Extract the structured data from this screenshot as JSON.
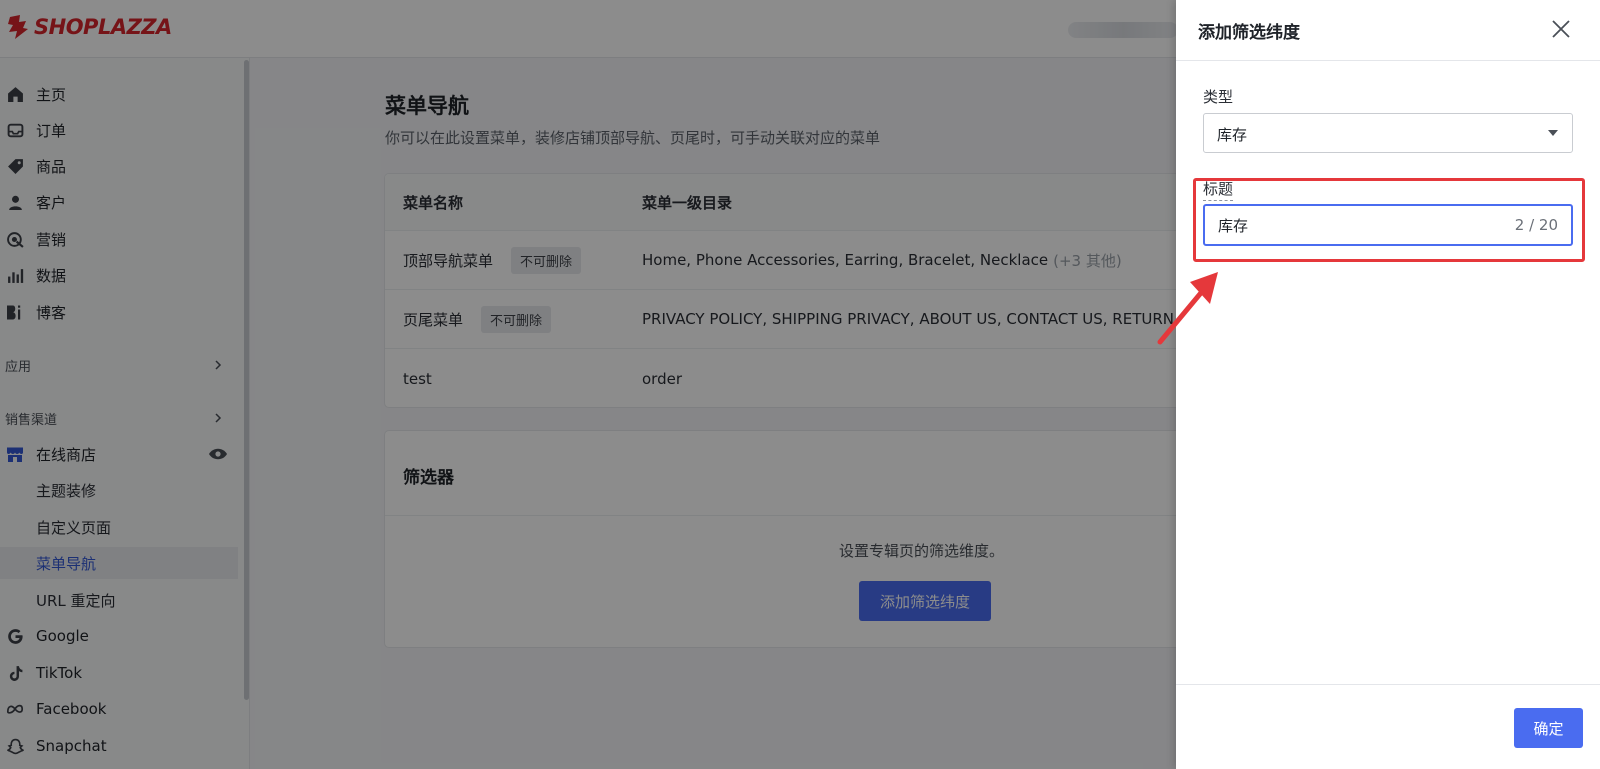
{
  "brand": {
    "name": "SHOPLAZZA",
    "color": "#d8262d"
  },
  "sidebar": {
    "main_items": [
      {
        "label": "主页",
        "icon": "home-icon"
      },
      {
        "label": "订单",
        "icon": "inbox-icon"
      },
      {
        "label": "商品",
        "icon": "tag-icon"
      },
      {
        "label": "客户",
        "icon": "user-icon"
      },
      {
        "label": "营销",
        "icon": "target-icon"
      },
      {
        "label": "数据",
        "icon": "bar-chart-icon"
      },
      {
        "label": "博客",
        "icon": "blog-icon"
      }
    ],
    "apps_label": "应用",
    "channels_label": "销售渠道",
    "online_store": {
      "label": "在线商店",
      "icon": "store-icon"
    },
    "store_sub_items": [
      "主题装修",
      "自定义页面",
      "菜单导航",
      "URL 重定向"
    ],
    "active_sub_item": "菜单导航",
    "channel_items": [
      {
        "label": "Google",
        "icon": "google-icon"
      },
      {
        "label": "TikTok",
        "icon": "tiktok-icon"
      },
      {
        "label": "Facebook",
        "icon": "meta-icon"
      },
      {
        "label": "Snapchat",
        "icon": "snapchat-icon"
      }
    ]
  },
  "main": {
    "title": "菜单导航",
    "description": "你可以在此设置菜单，装修店铺顶部导航、页尾时，可手动关联对应的菜单",
    "menus_table": {
      "headers": [
        "菜单名称",
        "菜单一级目录"
      ],
      "rows": [
        {
          "name": "顶部导航菜单",
          "tag": "不可删除",
          "items": "Home, Phone Accessories, Earring, Bracelet, Necklace",
          "more": "(+3 其他)"
        },
        {
          "name": "页尾菜单",
          "tag": "不可删除",
          "items": "PRIVACY POLICY, SHIPPING PRIVACY, ABOUT US, CONTACT US, RETURN",
          "more": ""
        },
        {
          "name": "test",
          "tag": "",
          "items": "order",
          "more": ""
        }
      ]
    },
    "filter": {
      "title": "筛选器",
      "hint": "设置专辑页的筛选维度。",
      "add_button": "添加筛选纬度"
    }
  },
  "drawer": {
    "title": "添加筛选纬度",
    "type_label": "类型",
    "type_value": "库存",
    "title_label": "标题",
    "title_value": "库存",
    "title_count": "2 / 20",
    "confirm_button": "确定"
  },
  "colors": {
    "primary": "#4a6cf0",
    "highlight": "#e5383b",
    "active_text": "#3358d4"
  }
}
